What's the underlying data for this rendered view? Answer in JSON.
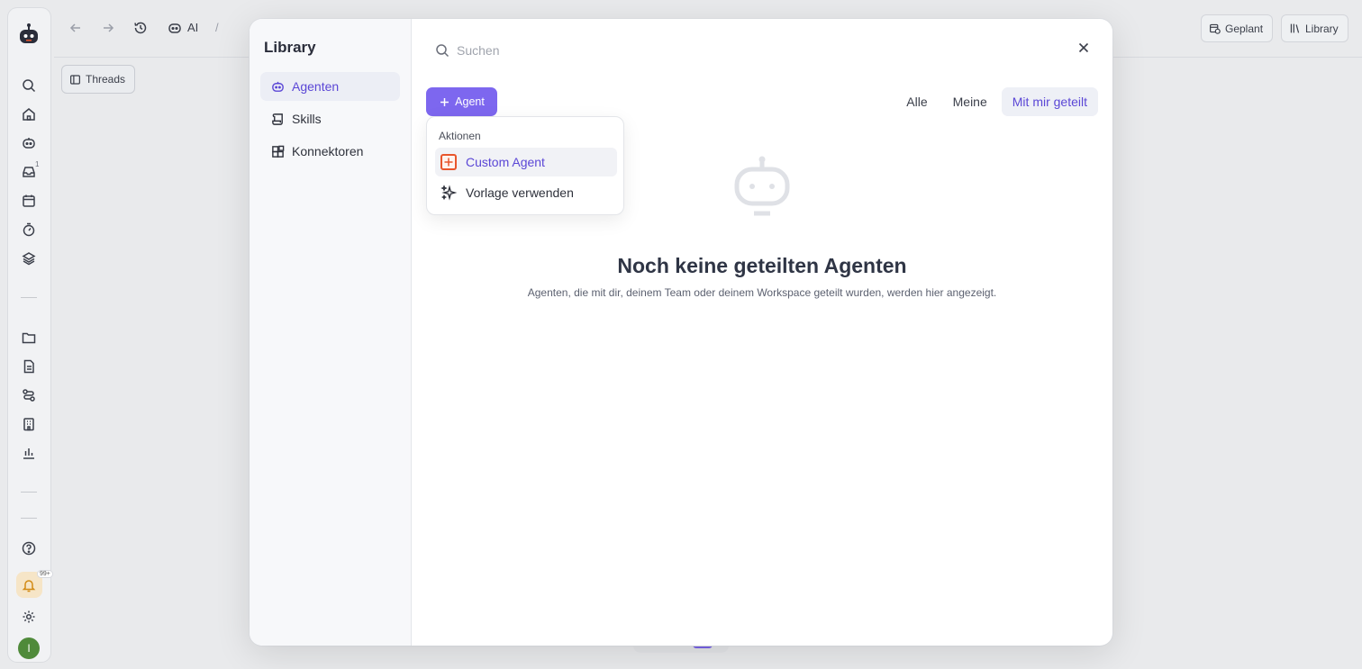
{
  "topbar": {
    "crumb_ai": "AI",
    "crumb_sep": "/",
    "geplant_label": "Geplant",
    "library_label": "Library",
    "threads_label": "Threads"
  },
  "rail": {
    "inbox_badge": "1",
    "notifications_badge": "99+",
    "avatar_initial": "I"
  },
  "modal": {
    "title": "Library",
    "nav": [
      {
        "label": "Agenten",
        "icon": "robot-icon",
        "active": true
      },
      {
        "label": "Skills",
        "icon": "scroll-icon",
        "active": false
      },
      {
        "label": "Konnektoren",
        "icon": "blocks-icon",
        "active": false
      }
    ],
    "search": {
      "placeholder": "Suchen",
      "value": ""
    },
    "agent_button_label": "Agent",
    "filters": [
      {
        "label": "Alle",
        "active": false
      },
      {
        "label": "Meine",
        "active": false
      },
      {
        "label": "Mit mir geteilt",
        "active": true
      }
    ],
    "empty": {
      "title": "Noch keine geteilten Agenten",
      "subtitle": "Agenten, die mit dir, deinem Team oder deinem Workspace geteilt wurden, werden hier angezeigt."
    },
    "dropdown": {
      "section_label": "Aktionen",
      "items": [
        {
          "label": "Custom Agent",
          "icon": "plus-square-icon",
          "highlighted": true
        },
        {
          "label": "Vorlage verwenden",
          "icon": "sparkles-icon",
          "highlighted": false
        }
      ]
    }
  },
  "colors": {
    "accent": "#7d67ef",
    "accent_text": "#5b47d6",
    "highlight_border": "#e8552c"
  }
}
